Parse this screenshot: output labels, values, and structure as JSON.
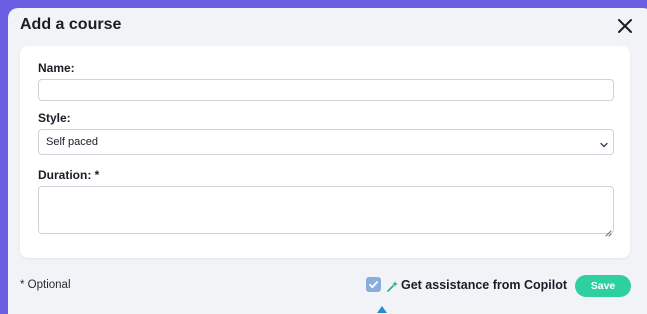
{
  "dialog": {
    "title": "Add a course",
    "close_icon": "close-icon"
  },
  "form": {
    "name": {
      "label": "Name:",
      "value": "",
      "placeholder": ""
    },
    "style": {
      "label": "Style:",
      "selected": "Self paced",
      "chevron_icon": "chevron-down-icon"
    },
    "duration": {
      "label": "Duration: *",
      "value": ""
    }
  },
  "footer": {
    "optional_note": "* Optional",
    "copilot_checkbox": {
      "checked": true,
      "icon": "copilot-sparkle-icon",
      "label": "Get assistance from Copilot"
    },
    "save_label": "Save"
  },
  "colors": {
    "backdrop": "#6a5ee3",
    "dialog_bg": "#f2f3f7",
    "card_bg": "#ffffff",
    "save_button": "#2ecfa1",
    "checkbox": "#8aaedc",
    "copilot_accent": "#22b07d"
  }
}
